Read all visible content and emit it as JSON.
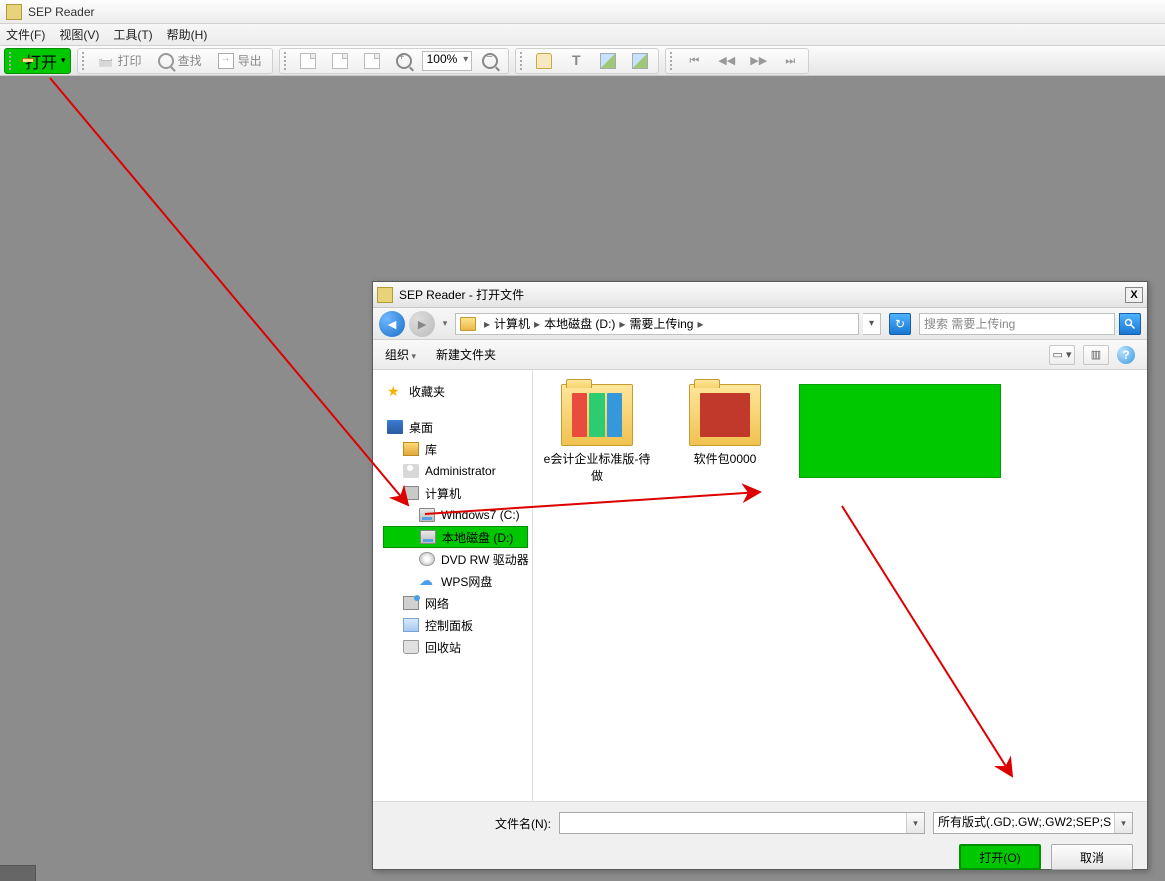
{
  "app": {
    "title": "SEP Reader"
  },
  "menu": {
    "file": "文件(F)",
    "view": "视图(V)",
    "tools": "工具(T)",
    "help": "帮助(H)"
  },
  "toolbar": {
    "open": "打开",
    "print": "打印",
    "find": "查找",
    "export": "导出",
    "zoom": "100%"
  },
  "dialog": {
    "title": "SEP Reader - 打开文件",
    "close": "X",
    "breadcrumb": {
      "p1": "计算机",
      "p2": "本地磁盘 (D:)",
      "p3": "需要上传ing"
    },
    "search_placeholder": "搜索 需要上传ing",
    "organize": "组织",
    "new_folder": "新建文件夹",
    "tree": {
      "favorites": "收藏夹",
      "desktop": "桌面",
      "libraries": "库",
      "admin": "Administrator",
      "computer": "计算机",
      "drive_c": "Windows7 (C:)",
      "drive_d": "本地磁盘 (D:)",
      "dvd": "DVD RW 驱动器 (",
      "wps": "WPS网盘",
      "network": "网络",
      "control_panel": "控制面板",
      "recycle": "回收站"
    },
    "files": {
      "f1": "e会计企业标准版-待做",
      "f2": "软件包0000"
    },
    "footer": {
      "filename_label": "文件名(N):",
      "filetype": "所有版式(.GD;.GW;.GW2;SEP;S",
      "open": "打开(O)",
      "cancel": "取消"
    }
  }
}
